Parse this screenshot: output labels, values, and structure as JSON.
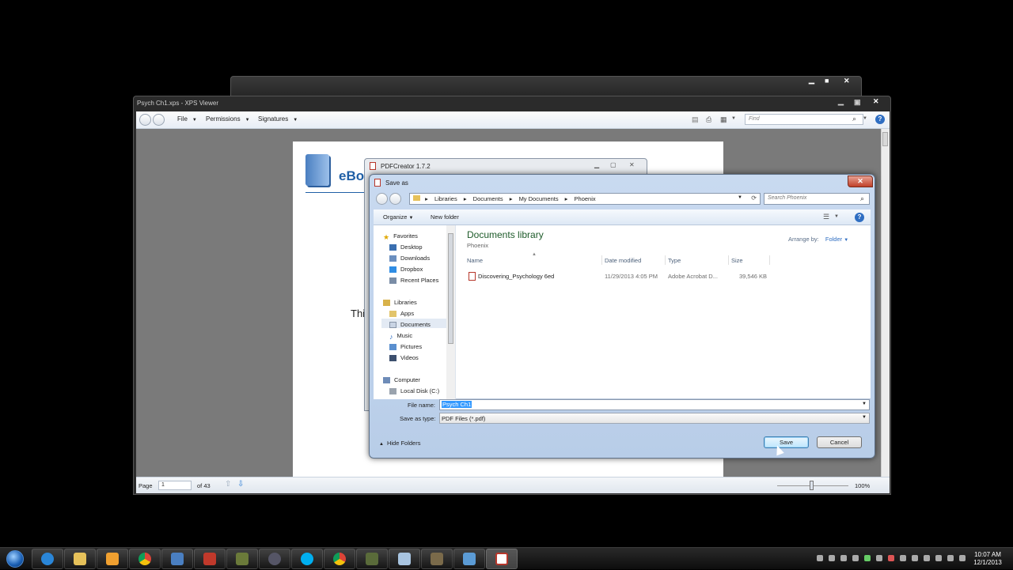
{
  "xps_viewer": {
    "title": "Psych Ch1.xps - XPS Viewer",
    "menus": [
      "File",
      "Permissions",
      "Signatures"
    ],
    "find_placeholder": "Find",
    "page_text_logo": "eBoo",
    "page_text_body": "Thi",
    "status": {
      "page_label": "Page",
      "page_value": "1",
      "of_label": "of 43",
      "zoom": "100%"
    }
  },
  "pdfcreator": {
    "title": "PDFCreator 1.7.2"
  },
  "save_as": {
    "title": "Save as",
    "breadcrumb": [
      "Libraries",
      "Documents",
      "My Documents",
      "Phoenix"
    ],
    "search_placeholder": "Search Phoenix",
    "toolbar": {
      "organize": "Organize",
      "new_folder": "New folder"
    },
    "nav": {
      "favorites": "Favorites",
      "favorites_items": [
        "Desktop",
        "Downloads",
        "Dropbox",
        "Recent Places"
      ],
      "libraries": "Libraries",
      "libraries_items": [
        "Apps",
        "Documents",
        "Music",
        "Pictures",
        "Videos"
      ],
      "computer": "Computer",
      "computer_items": [
        "Local Disk (C:)"
      ]
    },
    "library_title": "Documents library",
    "library_subtitle": "Phoenix",
    "arrange_by_label": "Arrange by:",
    "arrange_by_value": "Folder",
    "columns": [
      "Name",
      "Date modified",
      "Type",
      "Size"
    ],
    "files": [
      {
        "name": "Discovering_Psychology 6ed",
        "date": "11/29/2013 4:05 PM",
        "type": "Adobe Acrobat D...",
        "size": "39,546 KB"
      }
    ],
    "file_name_label": "File name:",
    "file_name_value": "Psych Ch1",
    "save_type_label": "Save as type:",
    "save_type_value": "PDF Files (*.pdf)",
    "hide_folders": "Hide Folders",
    "save_button": "Save",
    "cancel_button": "Cancel"
  },
  "taskbar": {
    "clock_time": "10:07 AM",
    "clock_date": "12/1/2013"
  },
  "colors": {
    "accent": "#1f5fa6",
    "library_title": "#1e5b2a",
    "selection": "#3399ff"
  }
}
